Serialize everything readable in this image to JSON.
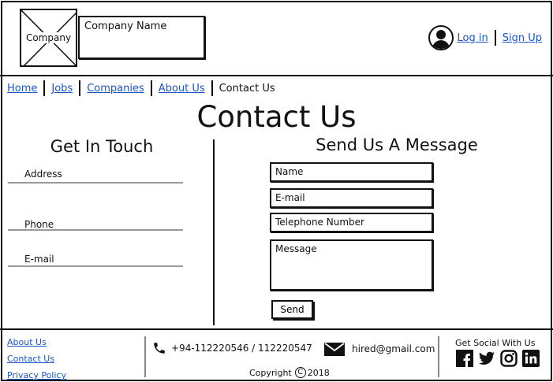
{
  "header": {
    "logo_label": "Company",
    "company_name": "Company Name",
    "login_label": "Log in",
    "signup_label": "Sign Up"
  },
  "nav": {
    "items": [
      "Home",
      "Jobs",
      "Companies",
      "About Us"
    ],
    "current": "Contact Us"
  },
  "page_title": "Contact Us",
  "get_in_touch": {
    "heading": "Get In Touch",
    "address_label": "Address",
    "phone_label": "Phone",
    "email_label": "E-mail"
  },
  "message_form": {
    "heading": "Send Us A Message",
    "name_placeholder": "Name",
    "email_placeholder": "E-mail",
    "telephone_placeholder": "Telephone Number",
    "message_placeholder": "Message",
    "send_label": "Send"
  },
  "footer": {
    "links": [
      "About Us",
      "Contact Us",
      "Privacy Policy"
    ],
    "phone": "+94-112220546 / 112220547",
    "email": "hired@gmail.com",
    "copyright_prefix": "Copyright",
    "copyright_year": "2018",
    "social_title": "Get Social With Us",
    "social_icons": [
      "facebook-icon",
      "twitter-icon",
      "instagram-icon",
      "linkedin-icon"
    ]
  }
}
